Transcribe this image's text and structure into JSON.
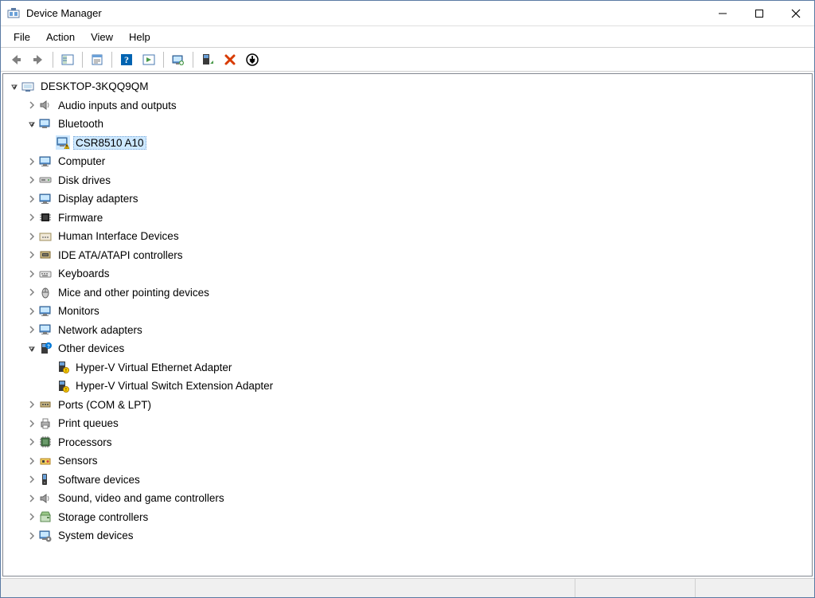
{
  "window": {
    "title": "Device Manager"
  },
  "menu": {
    "file": "File",
    "action": "Action",
    "view": "View",
    "help": "Help"
  },
  "tree": {
    "root": "DESKTOP-3KQQ9QM",
    "nodes": [
      {
        "label": "Audio inputs and outputs",
        "icon": "speaker",
        "state": "collapsed"
      },
      {
        "label": "Bluetooth",
        "icon": "monitor-bt",
        "state": "expanded",
        "children": [
          {
            "label": "CSR8510 A10",
            "icon": "monitor-bt-warn",
            "selected": true
          }
        ]
      },
      {
        "label": "Computer",
        "icon": "monitor",
        "state": "collapsed"
      },
      {
        "label": "Disk drives",
        "icon": "drive",
        "state": "collapsed"
      },
      {
        "label": "Display adapters",
        "icon": "monitor",
        "state": "collapsed"
      },
      {
        "label": "Firmware",
        "icon": "chip-dark",
        "state": "collapsed"
      },
      {
        "label": "Human Interface Devices",
        "icon": "hid",
        "state": "collapsed"
      },
      {
        "label": "IDE ATA/ATAPI controllers",
        "icon": "ide",
        "state": "collapsed"
      },
      {
        "label": "Keyboards",
        "icon": "keyboard",
        "state": "collapsed"
      },
      {
        "label": "Mice and other pointing devices",
        "icon": "mouse",
        "state": "collapsed"
      },
      {
        "label": "Monitors",
        "icon": "monitor",
        "state": "collapsed"
      },
      {
        "label": "Network adapters",
        "icon": "monitor",
        "state": "collapsed"
      },
      {
        "label": "Other devices",
        "icon": "unknown",
        "state": "expanded",
        "children": [
          {
            "label": "Hyper-V Virtual Ethernet Adapter",
            "icon": "unknown-item"
          },
          {
            "label": "Hyper-V Virtual Switch Extension Adapter",
            "icon": "unknown-item"
          }
        ]
      },
      {
        "label": "Ports (COM & LPT)",
        "icon": "port",
        "state": "collapsed"
      },
      {
        "label": "Print queues",
        "icon": "printer",
        "state": "collapsed"
      },
      {
        "label": "Processors",
        "icon": "cpu",
        "state": "collapsed"
      },
      {
        "label": "Sensors",
        "icon": "sensor",
        "state": "collapsed"
      },
      {
        "label": "Software devices",
        "icon": "software",
        "state": "collapsed"
      },
      {
        "label": "Sound, video and game controllers",
        "icon": "speaker",
        "state": "collapsed"
      },
      {
        "label": "Storage controllers",
        "icon": "storage",
        "state": "collapsed"
      },
      {
        "label": "System devices",
        "icon": "system",
        "state": "collapsed"
      }
    ]
  }
}
